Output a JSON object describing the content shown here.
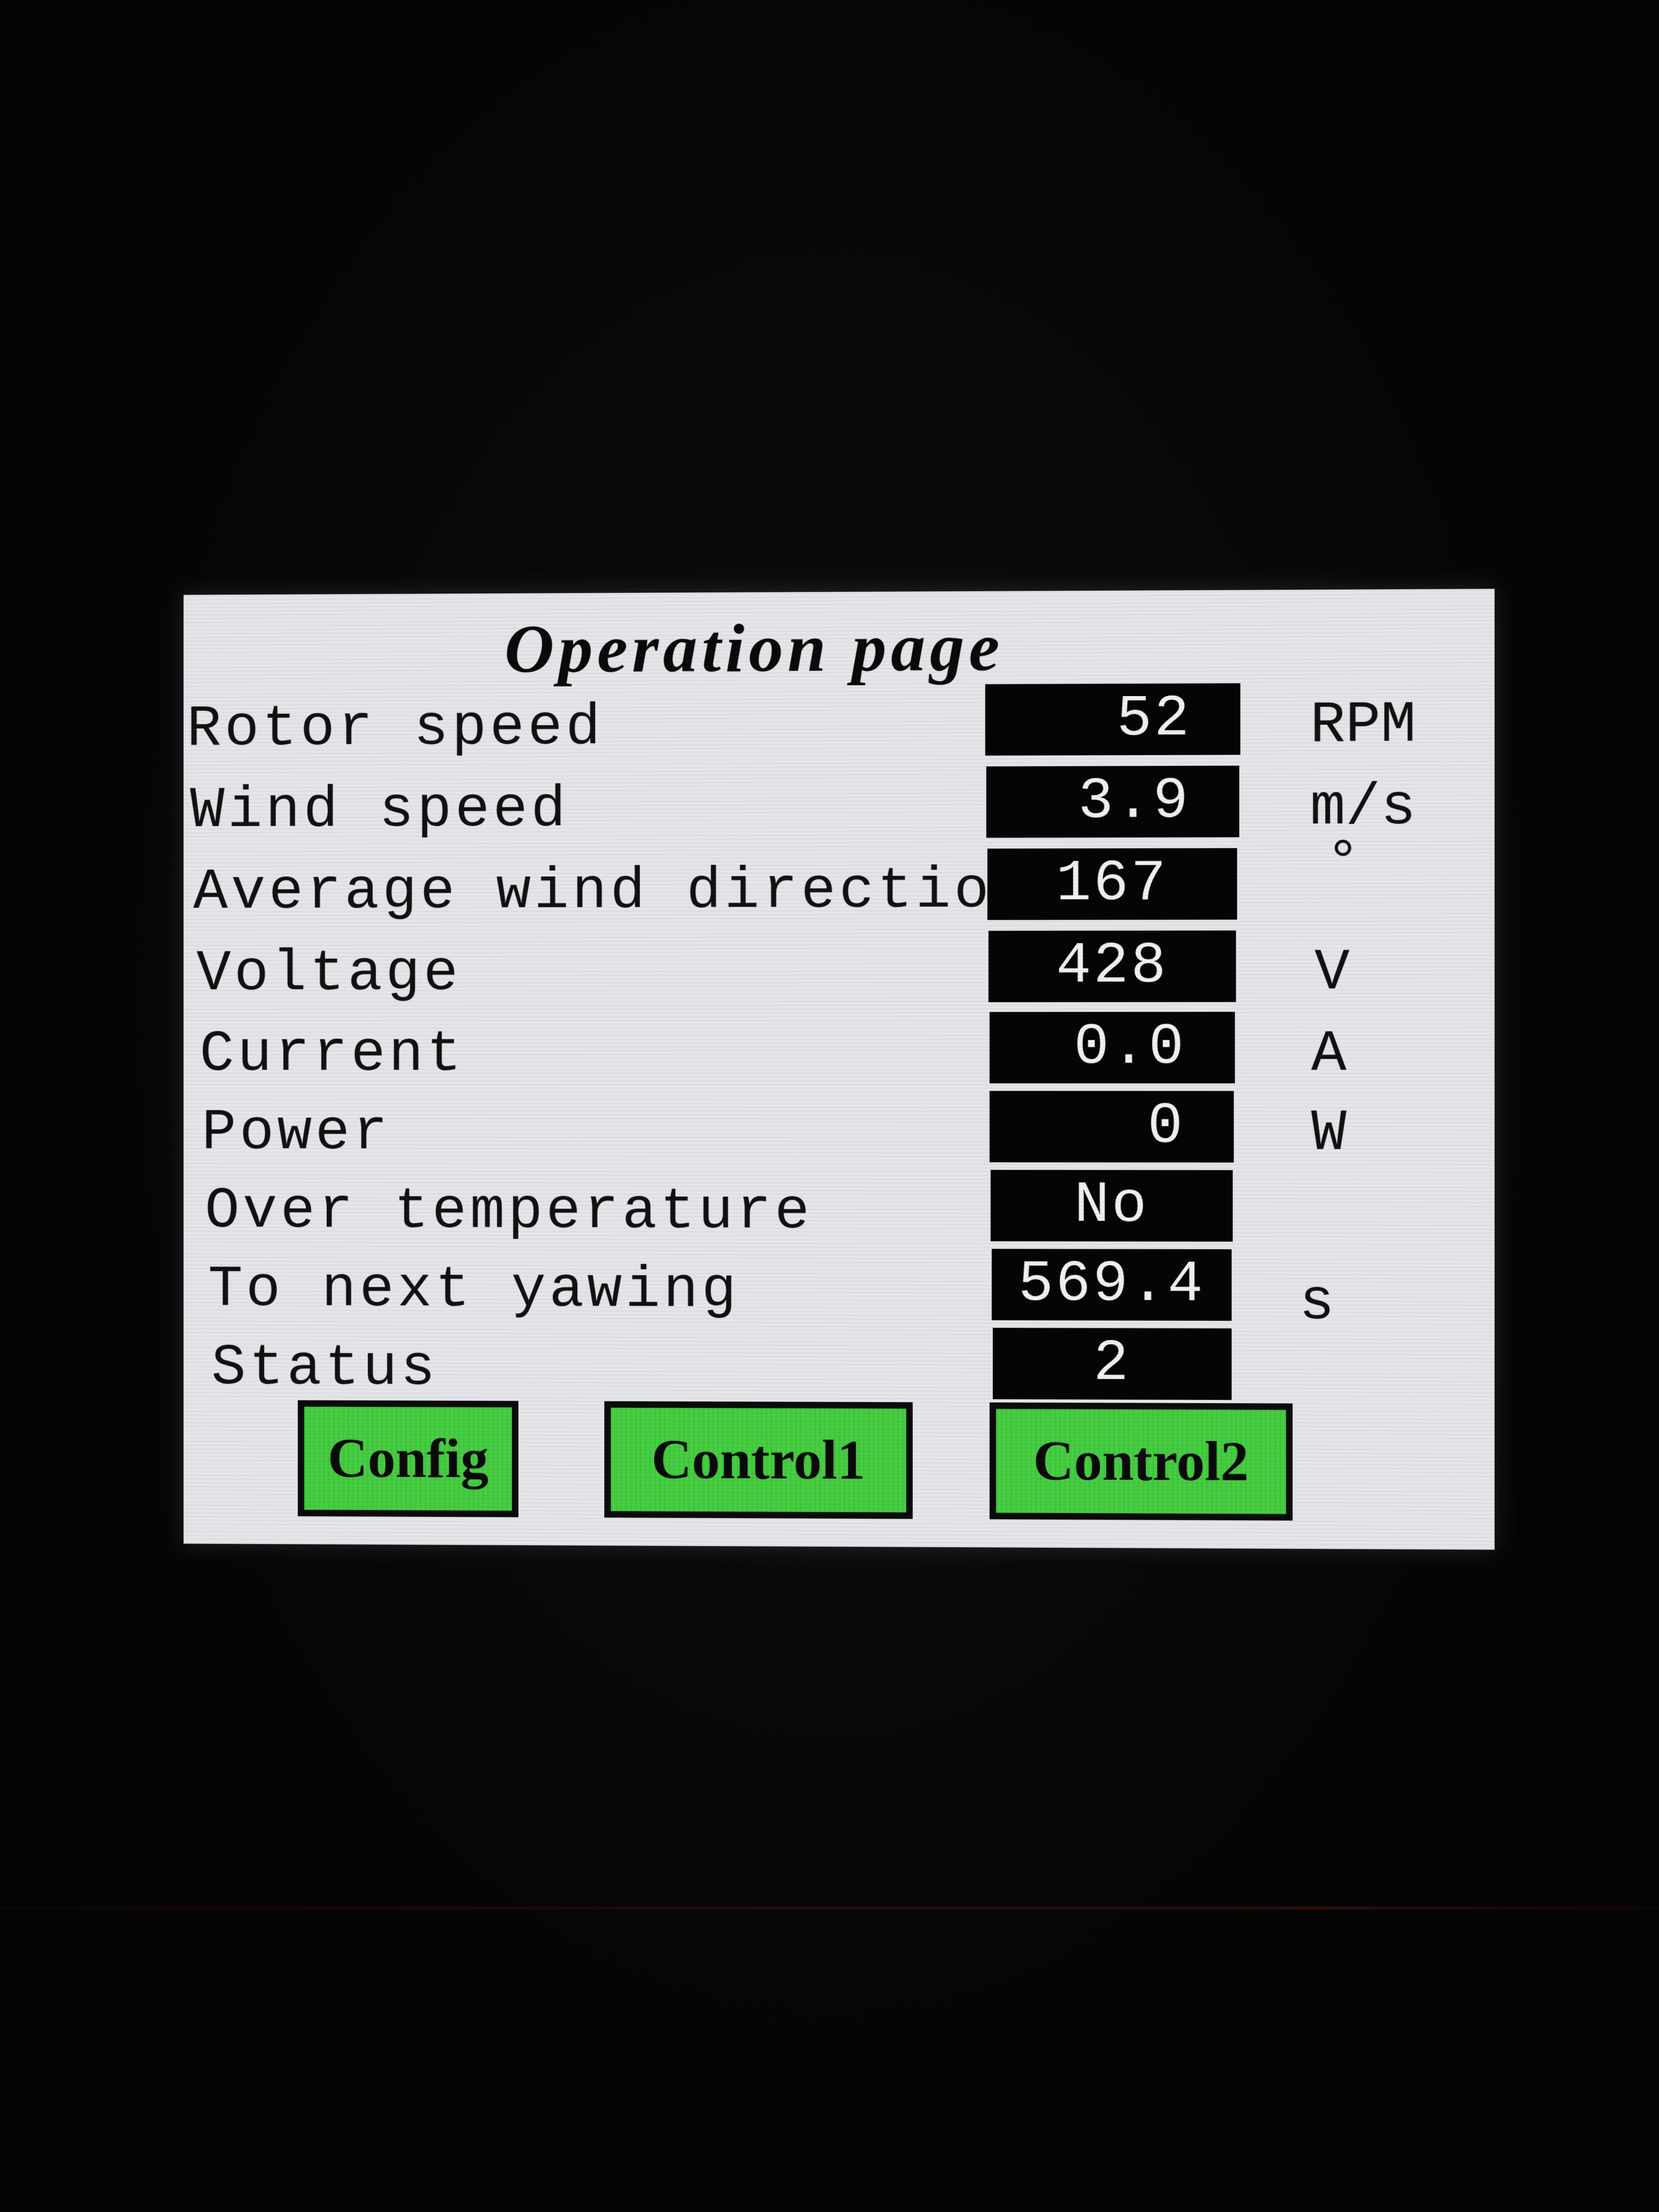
{
  "screen": {
    "title": "Operation page",
    "rows": [
      {
        "label": "Rotor speed",
        "value": "52",
        "unit": "RPM"
      },
      {
        "label": "Wind speed",
        "value": "3.9",
        "unit": "m/s"
      },
      {
        "label": "Average wind direction",
        "value": "167",
        "unit": "°"
      },
      {
        "label": "Voltage",
        "value": "428",
        "unit": "V"
      },
      {
        "label": "Current",
        "value": "0.0",
        "unit": "A"
      },
      {
        "label": "Power",
        "value": "0",
        "unit": "W"
      },
      {
        "label": "Over temperature",
        "value": "No",
        "unit": ""
      },
      {
        "label": "To next yawing",
        "value": "569.4",
        "unit": "s"
      },
      {
        "label": "Status",
        "value": "2",
        "unit": ""
      }
    ],
    "buttons": {
      "config": "Config",
      "control1": "Control1",
      "control2": "Control2"
    },
    "colors": {
      "screen_background": "#e4e6ea",
      "value_box": "#050505",
      "button_green": "#47d042"
    }
  }
}
